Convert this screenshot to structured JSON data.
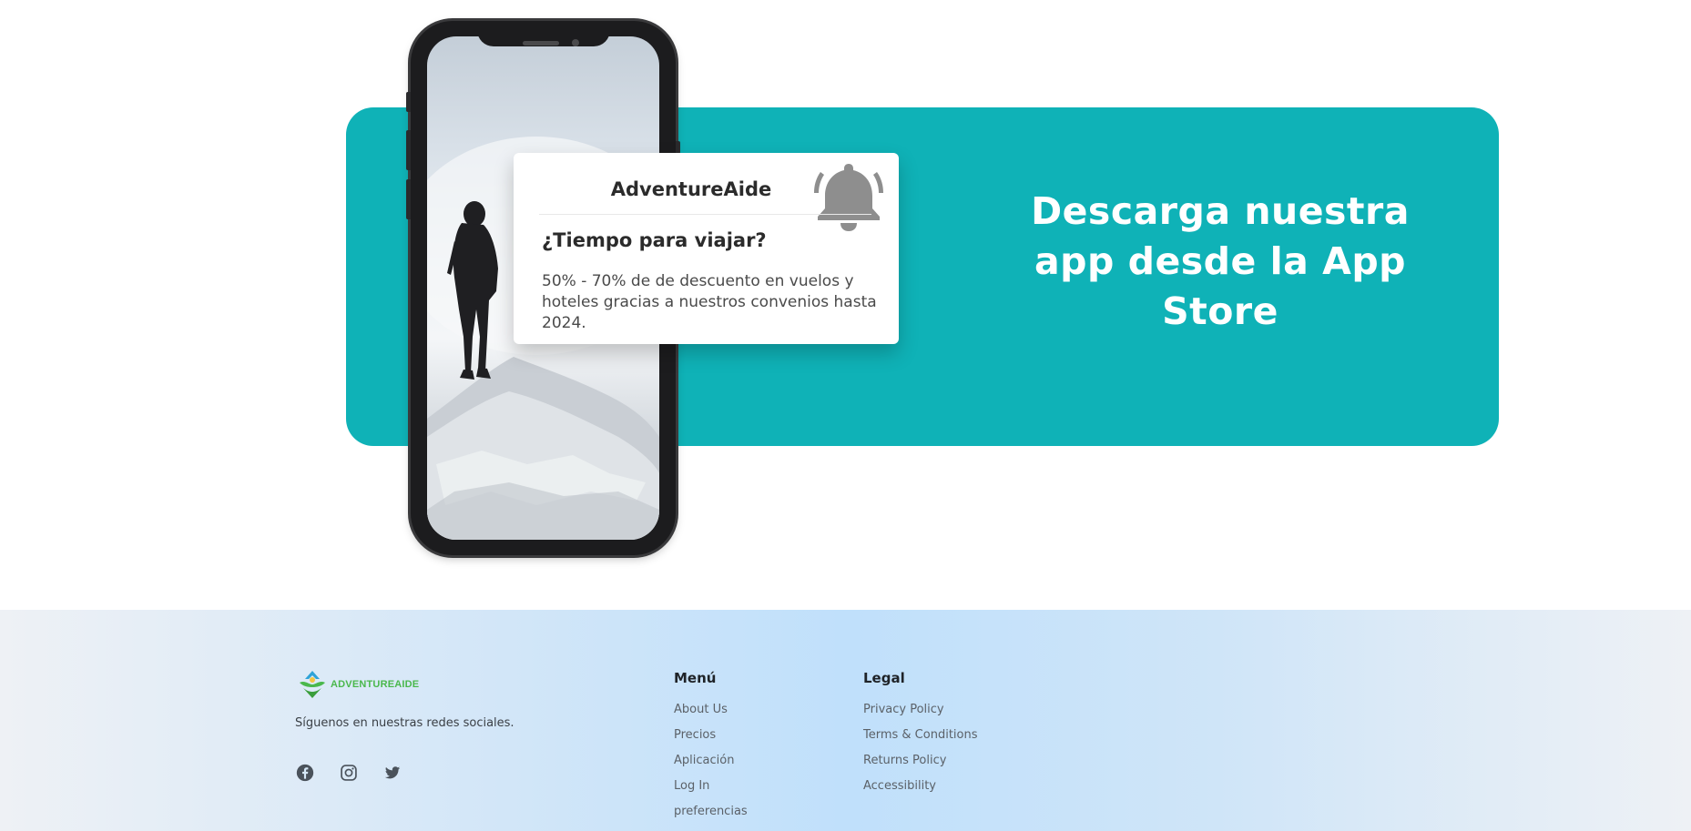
{
  "banner": {
    "headline": "Descarga nuestra app desde la App Store",
    "color": "#0fb2b7"
  },
  "notification": {
    "app_name": "AdventureAide",
    "title": "¿Tiempo para viajar?",
    "body": "50% - 70% de de descuento en vuelos y hoteles gracias a nuestros convenios hasta 2024.",
    "icon": "bell-icon"
  },
  "footer": {
    "logo_text": "ADVENTUREAIDE",
    "follow_text": "Síguenos en nuestras redes sociales.",
    "socials": [
      "facebook-icon",
      "instagram-icon",
      "twitter-icon"
    ],
    "menu": {
      "title": "Menú",
      "links": [
        "About Us",
        "Precios",
        "Aplicación",
        "Log In",
        "preferencias"
      ]
    },
    "legal": {
      "title": "Legal",
      "links": [
        "Privacy Policy",
        "Terms & Conditions",
        "Returns Policy",
        "Accessibility"
      ]
    },
    "brand_color": "#4ab84c"
  }
}
